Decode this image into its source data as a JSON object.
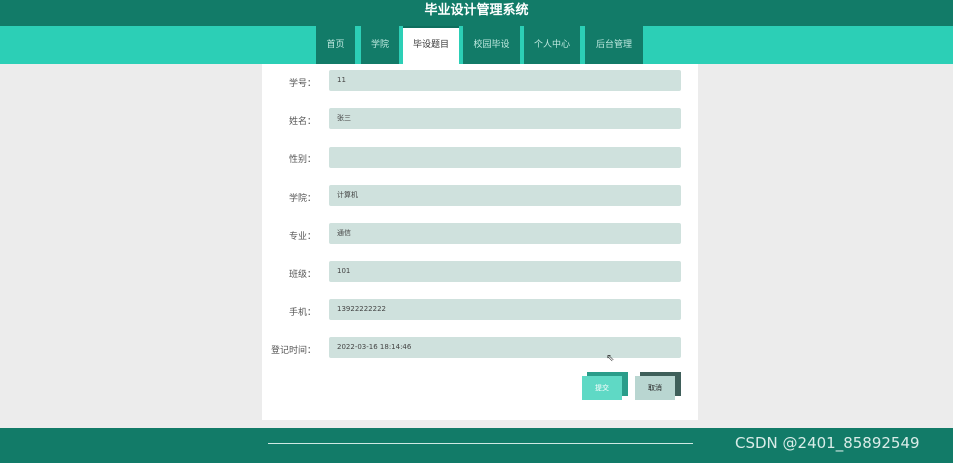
{
  "header": {
    "title": "毕业设计管理系统"
  },
  "nav": {
    "items": [
      {
        "label": "首页"
      },
      {
        "label": "学院"
      },
      {
        "label": "毕设题目"
      },
      {
        "label": "校园毕设"
      },
      {
        "label": "个人中心"
      },
      {
        "label": "后台管理"
      }
    ],
    "active_index": 2
  },
  "form": {
    "fields": [
      {
        "label": "学号：",
        "value": "11"
      },
      {
        "label": "姓名：",
        "value": "张三"
      },
      {
        "label": "性别：",
        "value": ""
      },
      {
        "label": "学院：",
        "value": "计算机"
      },
      {
        "label": "专业：",
        "value": "通信"
      },
      {
        "label": "班级：",
        "value": "101"
      },
      {
        "label": "手机：",
        "value": "13922222222"
      },
      {
        "label": "登记时间：",
        "value": "2022-03-16 18:14:46"
      }
    ],
    "submit_label": "提交",
    "cancel_label": "取消"
  },
  "watermark": "CSDN @2401_85892549",
  "colors": {
    "header": "#127b68",
    "nav_bar": "#2ccfb6",
    "input_bg": "#cfe1dd",
    "submit": "#5fd9c5",
    "cancel": "#b9d6d1"
  }
}
